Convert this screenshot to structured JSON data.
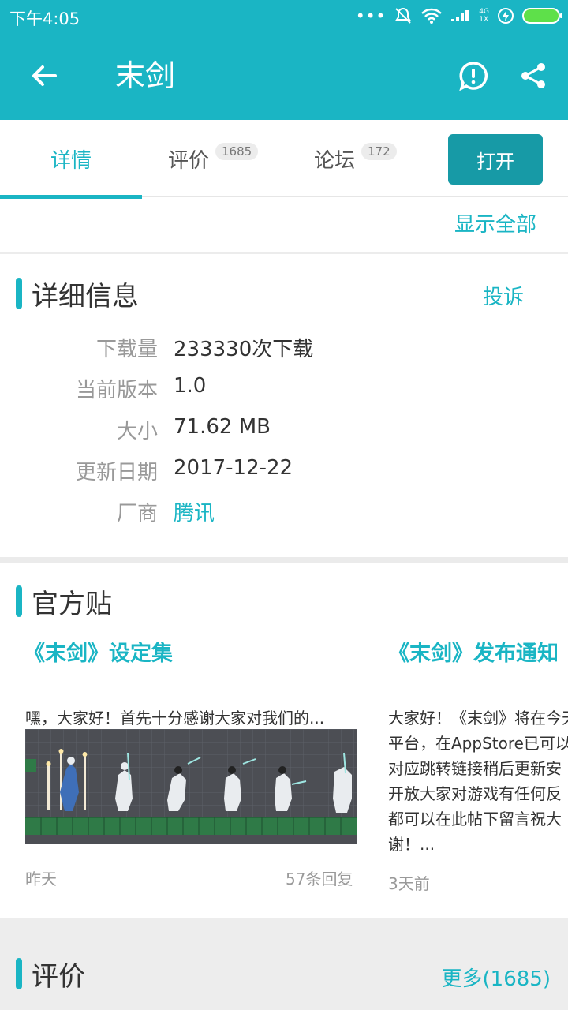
{
  "status_bar": {
    "time": "下午4:05",
    "network_type": "4G",
    "network_sub": "1X",
    "icons": [
      "more-dots-icon",
      "alarm-off-icon",
      "wifi-icon",
      "signal-icon",
      "charging-icon",
      "battery-icon"
    ]
  },
  "toolbar": {
    "title": "末剑",
    "back_icon": "arrow-left-icon",
    "report_icon": "alert-circle-icon",
    "share_icon": "share-icon"
  },
  "tabs": [
    {
      "label": "详情",
      "count": "",
      "active": true
    },
    {
      "label": "评价",
      "count": "1685",
      "active": false
    },
    {
      "label": "论坛",
      "count": "172",
      "active": false
    }
  ],
  "open_button": "打开",
  "show_all": "显示全部",
  "details": {
    "title": "详细信息",
    "complain": "投诉",
    "rows": [
      {
        "label": "下载量",
        "value": "233330次下载"
      },
      {
        "label": "当前版本",
        "value": "1.0"
      },
      {
        "label": "大小",
        "value": "71.62 MB"
      },
      {
        "label": "更新日期",
        "value": "2017-12-22"
      },
      {
        "label": "厂商",
        "value": "腾讯"
      }
    ]
  },
  "official_posts": {
    "title": "官方贴",
    "posts": [
      {
        "title": "《末剑》设定集",
        "excerpt": [
          "嘿，大家好！首先十分感谢大家对我们的..."
        ],
        "time": "昨天",
        "replies": "57条回复"
      },
      {
        "title": "《末剑》发布通知",
        "excerpt": [
          "大家好！《末剑》将在今天",
          "平台，在AppStore已可以",
          "对应跳转链接稍后更新安",
          "开放大家对游戏有任何反",
          "都可以在此帖下留言祝大",
          "谢！..."
        ],
        "time": "3天前",
        "replies": ""
      }
    ]
  },
  "reviews": {
    "title": "评价",
    "more": "更多(1685)"
  },
  "colors": {
    "accent": "#1ab5c4",
    "open_button": "#179aa6"
  }
}
